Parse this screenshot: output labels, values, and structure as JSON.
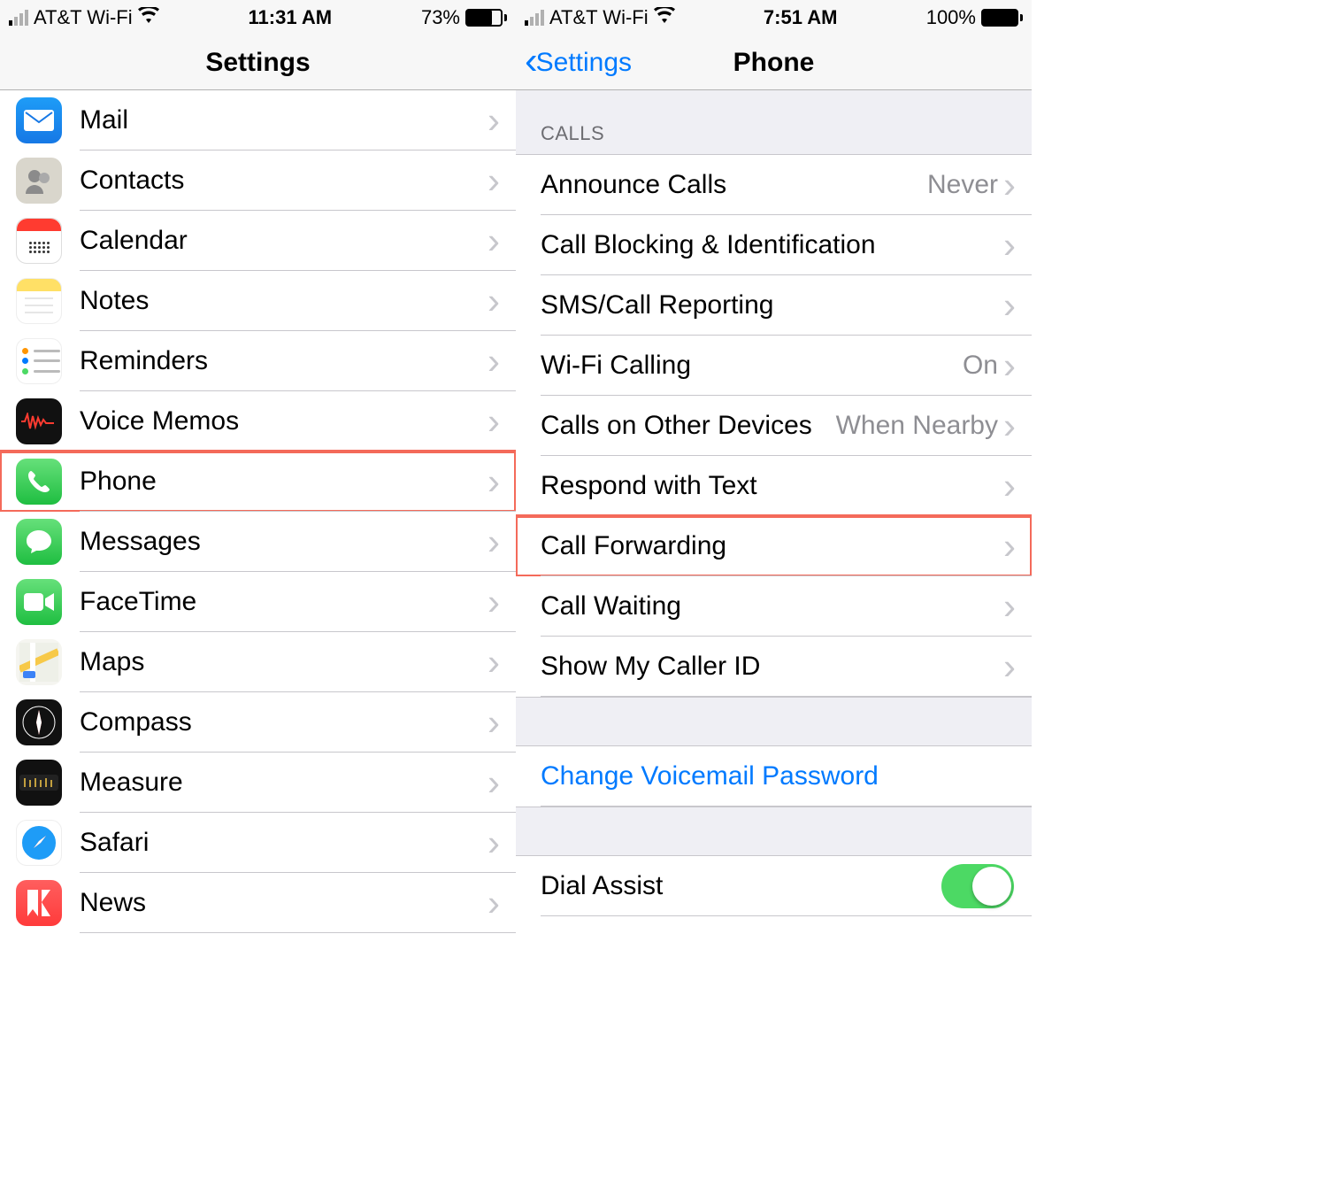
{
  "left": {
    "status": {
      "carrier": "AT&T Wi-Fi",
      "time": "11:31 AM",
      "battery_pct": "73%"
    },
    "title": "Settings",
    "items": [
      {
        "label": "Mail",
        "icon": "mail"
      },
      {
        "label": "Contacts",
        "icon": "contacts"
      },
      {
        "label": "Calendar",
        "icon": "calendar"
      },
      {
        "label": "Notes",
        "icon": "notes"
      },
      {
        "label": "Reminders",
        "icon": "reminders"
      },
      {
        "label": "Voice Memos",
        "icon": "voicememos"
      },
      {
        "label": "Phone",
        "icon": "phone"
      },
      {
        "label": "Messages",
        "icon": "messages"
      },
      {
        "label": "FaceTime",
        "icon": "facetime"
      },
      {
        "label": "Maps",
        "icon": "maps"
      },
      {
        "label": "Compass",
        "icon": "compass"
      },
      {
        "label": "Measure",
        "icon": "measure"
      },
      {
        "label": "Safari",
        "icon": "safari"
      },
      {
        "label": "News",
        "icon": "news"
      }
    ],
    "highlight_index": 6
  },
  "right": {
    "status": {
      "carrier": "AT&T Wi-Fi",
      "time": "7:51 AM",
      "battery_pct": "100%"
    },
    "back_label": "Settings",
    "title": "Phone",
    "section_header": "CALLS",
    "calls": [
      {
        "label": "Announce Calls",
        "value": "Never"
      },
      {
        "label": "Call Blocking & Identification",
        "value": ""
      },
      {
        "label": "SMS/Call Reporting",
        "value": ""
      },
      {
        "label": "Wi-Fi Calling",
        "value": "On"
      },
      {
        "label": "Calls on Other Devices",
        "value": "When Nearby"
      },
      {
        "label": "Respond with Text",
        "value": ""
      },
      {
        "label": "Call Forwarding",
        "value": ""
      },
      {
        "label": "Call Waiting",
        "value": ""
      },
      {
        "label": "Show My Caller ID",
        "value": ""
      }
    ],
    "highlight_index": 6,
    "voicemail_link": "Change Voicemail Password",
    "dial_assist_label": "Dial Assist",
    "dial_assist_on": true
  }
}
